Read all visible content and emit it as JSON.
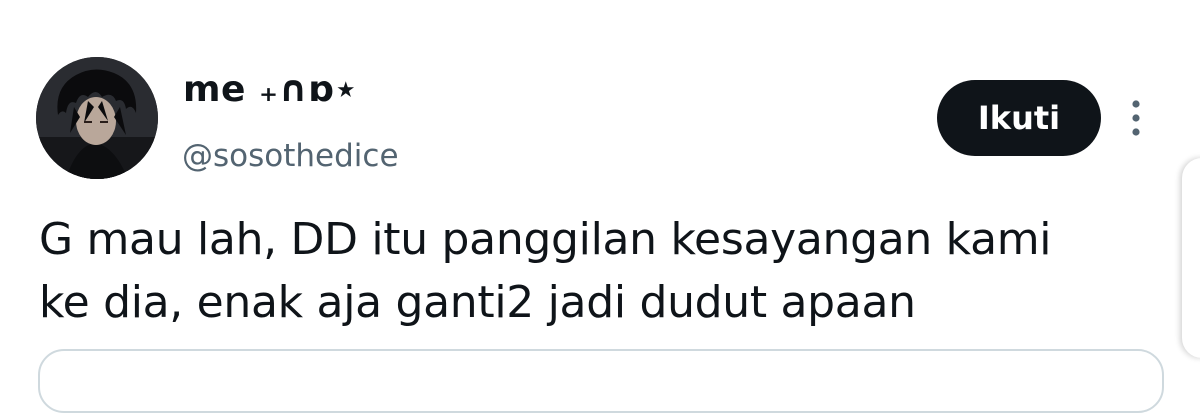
{
  "tweet": {
    "author": {
      "display_name": "me ₊∩ɒ⋆",
      "handle": "@sosothedice",
      "avatar_icon": "profile-avatar"
    },
    "follow_label": "Ikuti",
    "more_icon": "more-options-icon",
    "text_lines": [
      "G mau lah, DD itu panggilan kesayangan kami",
      "ke dia, enak aja ganti2 jadi dudut apaan"
    ]
  },
  "colors": {
    "text": "#0f1419",
    "secondary_text": "#536471",
    "button_bg": "#0f1419",
    "button_text": "#ffffff",
    "border": "#cfd9de"
  }
}
